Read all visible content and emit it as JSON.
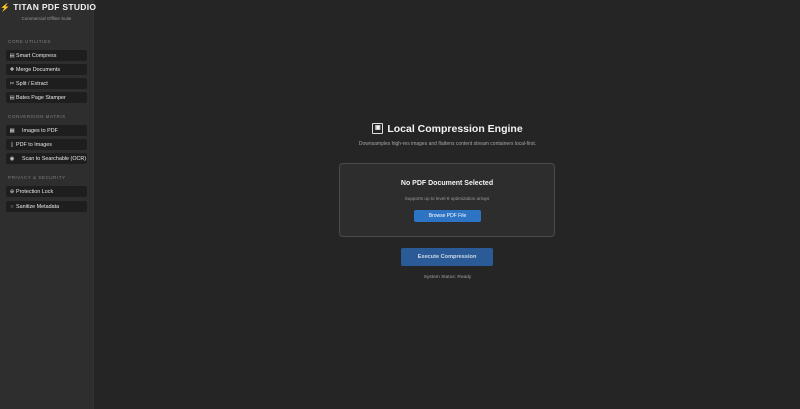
{
  "app": {
    "title": "TITAN PDF STUDIO",
    "subtitle": "Commercial Offline Suite",
    "icon": "lightning-bolt-icon"
  },
  "sidebar": {
    "sections": [
      {
        "label": "CORE UTILITIES",
        "items": [
          {
            "label": "Smart Compress",
            "icon": "compress-icon",
            "glyph": "▤"
          },
          {
            "label": "Merge Documents",
            "icon": "plus-icon",
            "glyph": "✚"
          },
          {
            "label": "Split / Extract",
            "icon": "scissors-icon",
            "glyph": "✂"
          },
          {
            "label": "Bates Page Stamper",
            "icon": "stamp-icon",
            "glyph": "▤"
          }
        ]
      },
      {
        "label": "CONVERSION MATRIX",
        "items": [
          {
            "label": "Images to PDF",
            "icon": "image-icon",
            "glyph": "▦"
          },
          {
            "label": "PDF to Images",
            "icon": "document-icon",
            "glyph": "▯"
          },
          {
            "label": "Scan to Searchable (OCR)",
            "icon": "scan-icon",
            "glyph": "◉"
          }
        ]
      },
      {
        "label": "PRIVACY & SECURITY",
        "items": [
          {
            "label": "Protection Lock",
            "icon": "lock-icon",
            "glyph": "⊕"
          },
          {
            "label": "Sanitize Metadata",
            "icon": "sanitize-icon",
            "glyph": "○"
          }
        ]
      }
    ]
  },
  "main": {
    "title": "Local Compression Engine",
    "title_icon": "compression-engine-icon",
    "subtitle": "Downsamples high-res images and flattens content stream containers local-first.",
    "dropzone": {
      "title": "No PDF Document Selected",
      "subtitle": "Supports up to level-9 optimization arrays",
      "browse_label": "Browse PDF File"
    },
    "execute_label": "Execute Compression",
    "status": "System Status: Ready"
  },
  "colors": {
    "background": "#252525",
    "sidebar": "#2e2e2e",
    "accent": "#2d74c4",
    "execute": "#2a5b96"
  }
}
